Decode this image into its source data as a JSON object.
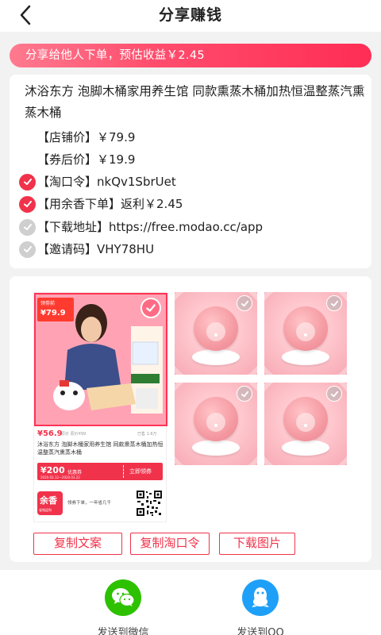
{
  "header": {
    "title": "分享赚钱"
  },
  "banner": {
    "text": "分享给他人下单，预估收益￥2.45"
  },
  "product": {
    "title": "沐浴东方 泡脚木桶家用养生馆 同款熏蒸木桶加热恒温整蒸汽熏蒸木桶",
    "rows": [
      {
        "text": "【店铺价】￥79.9",
        "check": "none"
      },
      {
        "text": "【券后价】￥19.9",
        "check": "none"
      },
      {
        "text": "【淘口令】nkQv1SbrUet",
        "check": "on"
      },
      {
        "text": "【用余香下单】返利￥2.45",
        "check": "on"
      },
      {
        "text": "【下载地址】https://free.modao.cc/app",
        "check": "off"
      },
      {
        "text": "【邀请码】VHY78HU",
        "check": "off"
      }
    ]
  },
  "poster": {
    "tag_label": "领劵前",
    "tag_price": "¥79.9",
    "price": "¥56.9",
    "sub": "原价 原价¥99",
    "sold": "已售 1.6万",
    "desc": "沐浴东方 泡脚木桶家用养生馆 同款熏蒸木桶加热恒温整蒸汽熏蒸木桶",
    "coupon_amount": "¥200",
    "coupon_unit": "优惠券",
    "coupon_date": "2020.03.12—2020.03.22",
    "coupon_get": "立即领券",
    "logo_text": "余香",
    "logo_sub": "省钱返利",
    "slogan": "领券下单，一年省几千"
  },
  "actions": {
    "copy_text": "复制文案",
    "copy_token": "复制淘口令",
    "download": "下载图片"
  },
  "share": {
    "wechat": "发送到微信",
    "qq": "发送到QQ"
  },
  "colors": {
    "accent": "#f0334b",
    "wechat": "#2dc100",
    "qq": "#1fa0f8"
  },
  "icons": [
    "back-icon",
    "check-icon",
    "wechat-icon",
    "qq-icon",
    "qr-code"
  ]
}
